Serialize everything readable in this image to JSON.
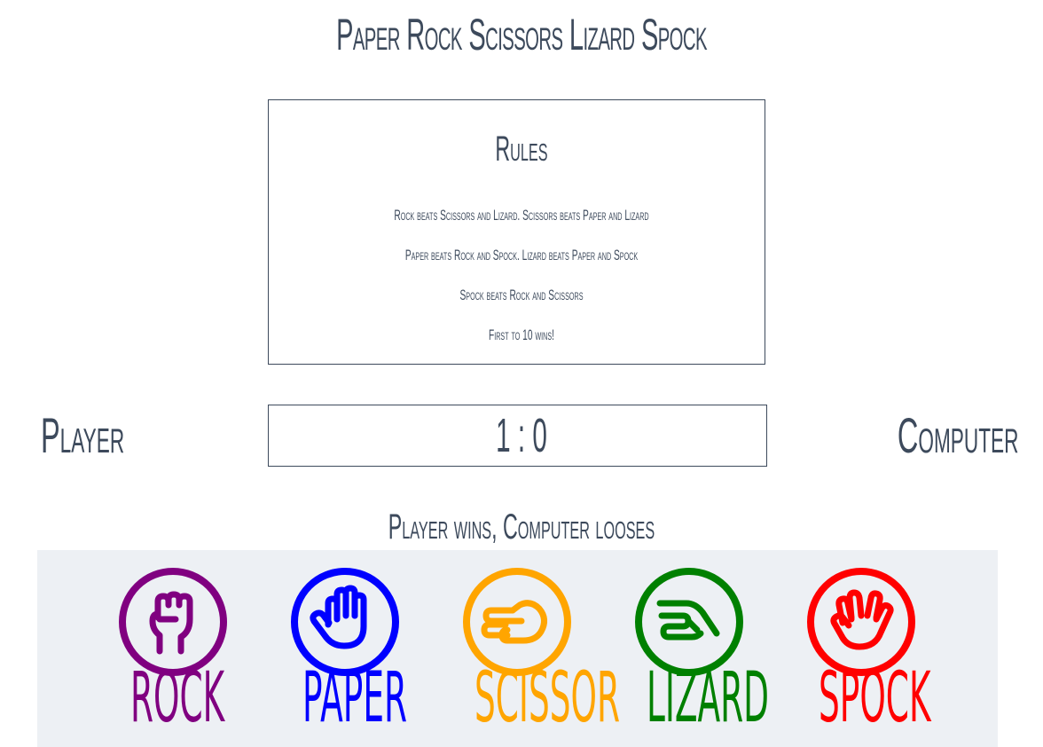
{
  "title": "Paper Rock Scissors Lizard Spock",
  "rules": {
    "heading": "Rules",
    "lines": [
      "Rock beats Scissors and Lizard. Scissors beats Paper and Lizard",
      "Paper beats Rock and Spock. Lizard beats Paper and Spock",
      "Spock beats Rock and Scissors",
      "First to 10 wins!"
    ]
  },
  "scoreboard": {
    "player_label": "Player",
    "computer_label": "Computer",
    "score": "1 : 0"
  },
  "result": "Player wins, Computer looses",
  "choices": [
    {
      "label": "ROCK",
      "color": "#800080",
      "icon": "rock-fist-icon"
    },
    {
      "label": "PAPER",
      "color": "#0000ff",
      "icon": "paper-hand-icon"
    },
    {
      "label": "SCISSOR",
      "color": "#ffa500",
      "icon": "scissors-hand-icon"
    },
    {
      "label": "LIZARD",
      "color": "#008000",
      "icon": "lizard-hand-icon"
    },
    {
      "label": "SPOCK",
      "color": "#ff0000",
      "icon": "spock-hand-icon"
    }
  ],
  "colors": {
    "text": "#3d4a5c",
    "panel": "#edf0f4"
  }
}
